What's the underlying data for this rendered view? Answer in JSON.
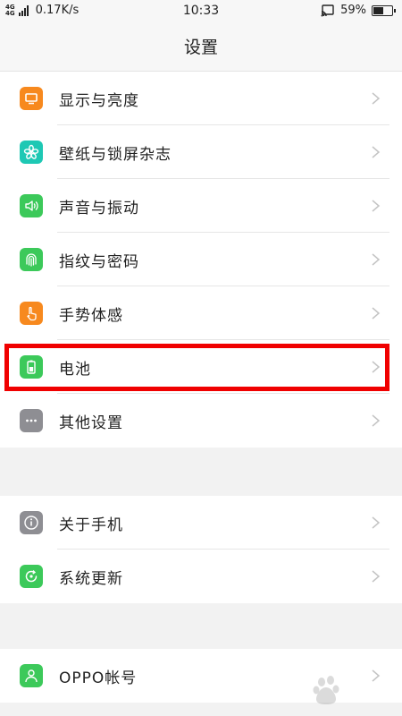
{
  "status_bar": {
    "network_top": "4G",
    "network_bottom": "4G",
    "speed": "0.17K/s",
    "time": "10:33",
    "battery_percent": "59%",
    "battery_level": 0.59
  },
  "header": {
    "title": "设置"
  },
  "colors": {
    "orange": "#f7891e",
    "teal": "#1ec8b4",
    "green": "#3cc95a",
    "gray": "#8e8e93",
    "highlight": "#f00000"
  },
  "groups": [
    [
      {
        "label": "显示与亮度",
        "icon": "display-icon",
        "color": "#f7891e"
      },
      {
        "label": "壁纸与锁屏杂志",
        "icon": "wallpaper-flower-icon",
        "color": "#1ec8b4"
      },
      {
        "label": "声音与振动",
        "icon": "speaker-icon",
        "color": "#3cc95a"
      },
      {
        "label": "指纹与密码",
        "icon": "fingerprint-icon",
        "color": "#3cc95a"
      },
      {
        "label": "手势体感",
        "icon": "gesture-hand-icon",
        "color": "#f7891e"
      },
      {
        "label": "电池",
        "icon": "battery-icon",
        "color": "#3cc95a"
      },
      {
        "label": "其他设置",
        "icon": "more-dots-icon",
        "color": "#8e8e93"
      }
    ],
    [
      {
        "label": "关于手机",
        "icon": "info-icon",
        "color": "#8e8e93"
      },
      {
        "label": "系统更新",
        "icon": "update-icon",
        "color": "#3cc95a"
      }
    ],
    [
      {
        "label": "OPPO帐号",
        "icon": "account-icon",
        "color": "#3cc95a"
      }
    ]
  ]
}
